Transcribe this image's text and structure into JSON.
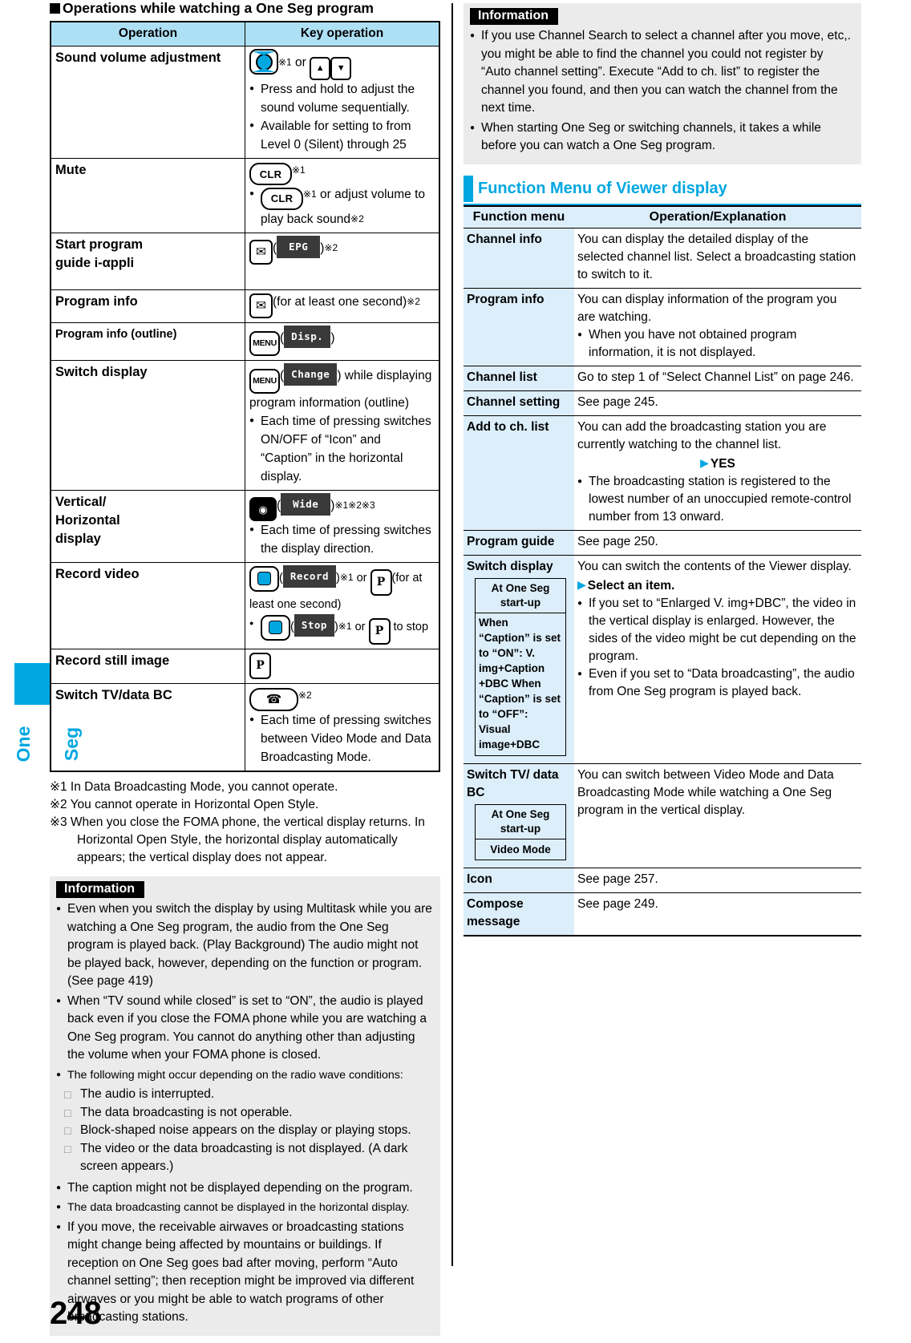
{
  "page": {
    "number": "248",
    "chapter_tab": "One Seg",
    "accent_color": "#00A7E1"
  },
  "left": {
    "section_title": "Operations while watching a One Seg program",
    "ops_table": {
      "headers": [
        "Operation",
        "Key operation"
      ],
      "rows": [
        {
          "operation": "Sound volume adjustment",
          "key_main": "※1 or",
          "bullets": [
            "Press and hold to adjust the sound volume sequentially.",
            "Available for setting to from Level 0 (Silent) through 25"
          ],
          "key_glyphs": [
            "nav-key",
            "up-arrow-key",
            "down-arrow-key"
          ]
        },
        {
          "operation": "Mute",
          "key_label": "CLR",
          "key_sup": "※1",
          "bullets_rich": [
            {
              "pre": "",
              "key": "CLR",
              "sup": "※1",
              "post": " or adjust volume to play back sound",
              "post_sup": "※2"
            }
          ]
        },
        {
          "operation": "Start program guide i-αppli",
          "softkey": "EPG",
          "sup": "※2"
        },
        {
          "operation": "Program info",
          "text": "(for at least one second)",
          "sup": "※2"
        },
        {
          "operation": "Program info (outline)",
          "menu_key": "MENU",
          "softkey": "Disp."
        },
        {
          "operation": "Switch display",
          "menu_key": "MENU",
          "softkey": "Change",
          "text": ") while displaying program information (outline)",
          "bullets": [
            "Each time of pressing switches ON/OFF of “Icon” and “Caption” in the horizontal display."
          ]
        },
        {
          "operation": "Vertical/ Horizontal display",
          "softkey": "Wide",
          "sup": "※1※2※3",
          "bullets": [
            "Each time of pressing switches the display direction."
          ]
        },
        {
          "operation": "Record video",
          "softkey": "Record",
          "sup": "※1",
          "text_after": "(for at least one second)",
          "softkey2": "Stop",
          "sup2": "※1",
          "text_after2": "to stop",
          "or_label": "or"
        },
        {
          "operation": "Record still image",
          "key_glyph": "i-mode-key"
        },
        {
          "operation": "Switch TV/data BC",
          "sup": "※2",
          "bullets": [
            "Each time of pressing switches between Video Mode and Data Broadcasting Mode."
          ]
        }
      ]
    },
    "footnotes": [
      {
        "mark": "※1",
        "text": "In Data Broadcasting Mode, you cannot operate."
      },
      {
        "mark": "※2",
        "text": "You cannot operate in Horizontal Open Style."
      },
      {
        "mark": "※3",
        "text": "When you close the FOMA phone, the vertical display returns. In Horizontal Open Style, the horizontal display automatically appears; the vertical display does not appear."
      }
    ],
    "information": {
      "tag": "Information",
      "bullets": [
        "Even when you switch the display by using Multitask while you are watching a One Seg program, the audio from the One Seg program is played back. (Play Background) The audio might not be played back, however, depending on the function or program. (See page 419)",
        "When “TV sound while closed” is set to “ON”, the audio is played back even if you close the FOMA phone while you are watching a One Seg program. You cannot do anything other than adjusting the volume when your FOMA phone is closed."
      ],
      "conditions_intro": "The following might occur depending on the radio wave conditions:",
      "conditions": [
        "The audio is interrupted.",
        "The data broadcasting is not operable.",
        "Block-shaped noise appears on the display or playing stops.",
        "The video or the data broadcasting is not displayed. (A dark screen appears.)"
      ],
      "bullets_after": [
        "The caption might not be displayed depending on the program.",
        "The data broadcasting cannot be displayed in the horizontal display.",
        "If you move, the receivable airwaves or broadcasting stations might change being affected by mountains or buildings. If reception on One Seg goes bad after moving, perform “Auto channel setting”; then reception might be improved via different airwaves or you might be able to watch programs of other broadcasting stations."
      ]
    }
  },
  "right": {
    "information": {
      "tag": "Information",
      "bullets": [
        "If you use Channel Search to select a channel after you move, etc,. you might be able to find the channel you could not register by “Auto channel setting”. Execute “Add to ch. list” to register the channel you found, and then you can watch the channel from the next time.",
        "When starting One Seg or switching channels, it takes a while before you can watch a One Seg program."
      ]
    },
    "section_title": "Function Menu of Viewer display",
    "fn_table": {
      "headers": [
        "Function menu",
        "Operation/Explanation"
      ],
      "rows": [
        {
          "menu": "Channel info",
          "text": "You can display the detailed display of the selected channel list. Select a broadcasting station to switch to it."
        },
        {
          "menu": "Program info",
          "text": "You can display information of the program you are watching.",
          "bullets": [
            "When you have not obtained program information, it is not displayed."
          ]
        },
        {
          "menu": "Channel list",
          "text": "Go to step 1 of “Select Channel List” on page 246."
        },
        {
          "menu": "Channel setting",
          "text": "See page 245."
        },
        {
          "menu": "Add to ch. list",
          "text": "You can add the broadcasting station you are currently watching to the channel list.",
          "step": "YES",
          "bullets": [
            "The broadcasting station is registered to the lowest number of an unoccupied remote-control number from 13 onward."
          ]
        },
        {
          "menu": "Program guide",
          "text": "See page 250."
        },
        {
          "menu": "Switch display",
          "text": "You can switch the contents of the Viewer display.",
          "step": "Select an item.",
          "bullets": [
            "If you set to “Enlarged V. img+DBC”, the video in the vertical display is enlarged. However, the sides of the video might be cut depending on the program.",
            "Even if you set to “Data broadcasting”, the audio from One Seg program is played back."
          ],
          "minibox": {
            "header": "At One Seg start-up",
            "body": "When “Caption” is set to “ON”: V. img+Caption +DBC When “Caption” is set to “OFF”: Visual image+DBC"
          }
        },
        {
          "menu": "Switch TV/ data BC",
          "text": "You can switch between Video Mode and Data Broadcasting Mode while watching a One Seg program in the vertical display.",
          "minibox": {
            "header": "At One Seg start-up",
            "body": "Video Mode"
          }
        },
        {
          "menu": "Icon",
          "text": "See page 257."
        },
        {
          "menu": "Compose message",
          "text": "See page 249."
        }
      ]
    }
  }
}
